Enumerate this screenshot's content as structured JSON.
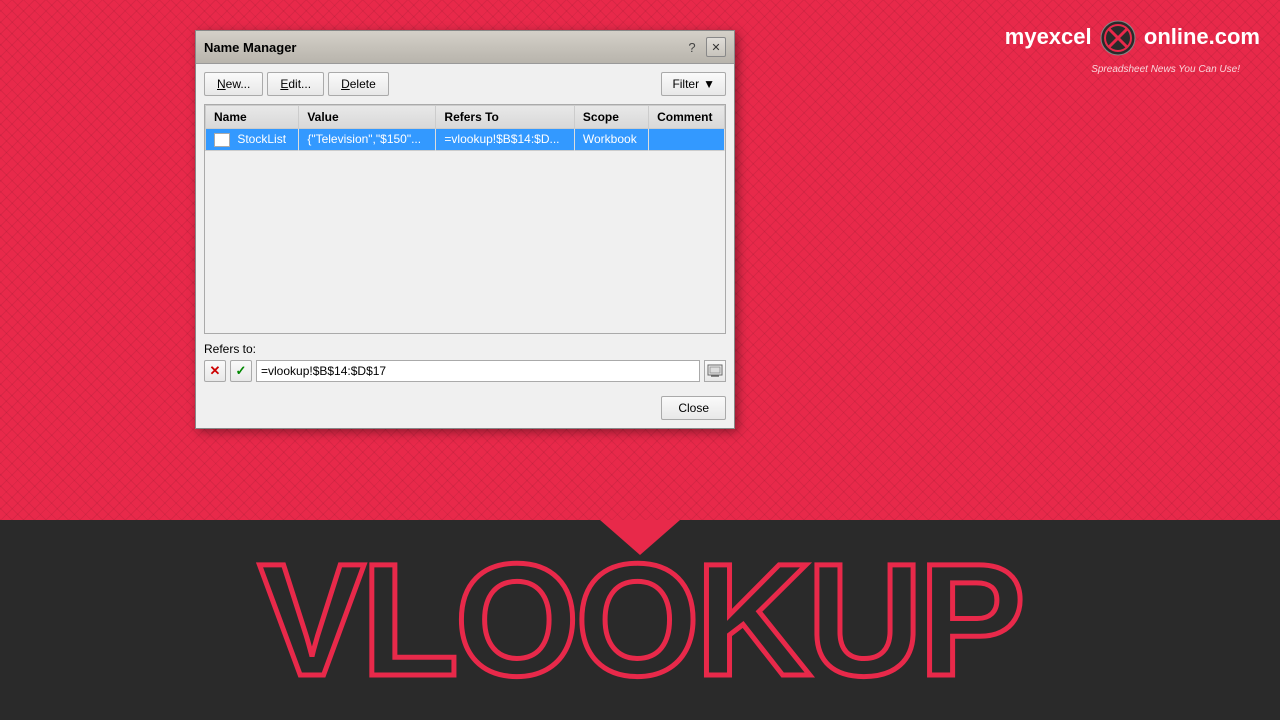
{
  "logo": {
    "text_my": "my",
    "text_excel": "excel",
    "text_online": "online.com",
    "tagline": "Spreadsheet News You Can Use!"
  },
  "dialog": {
    "title": "Name Manager",
    "help_label": "?",
    "close_label": "✕",
    "toolbar": {
      "new_label": "New...",
      "edit_label": "Edit...",
      "delete_label": "Delete",
      "filter_label": "Filter"
    },
    "table": {
      "columns": [
        "Name",
        "Value",
        "Refers To",
        "Scope",
        "Comment"
      ],
      "rows": [
        {
          "name": "StockList",
          "value": "{\"Television\",\"$150\"...",
          "refers_to": "=vlookup!$B$14:$D...",
          "scope": "Workbook",
          "comment": ""
        }
      ]
    },
    "refers_to_label": "Refers to:",
    "refers_to_value": "=vlookup!$B$14:$D$17",
    "close_button_label": "Close"
  },
  "bottom_text": "VLOOKUP"
}
